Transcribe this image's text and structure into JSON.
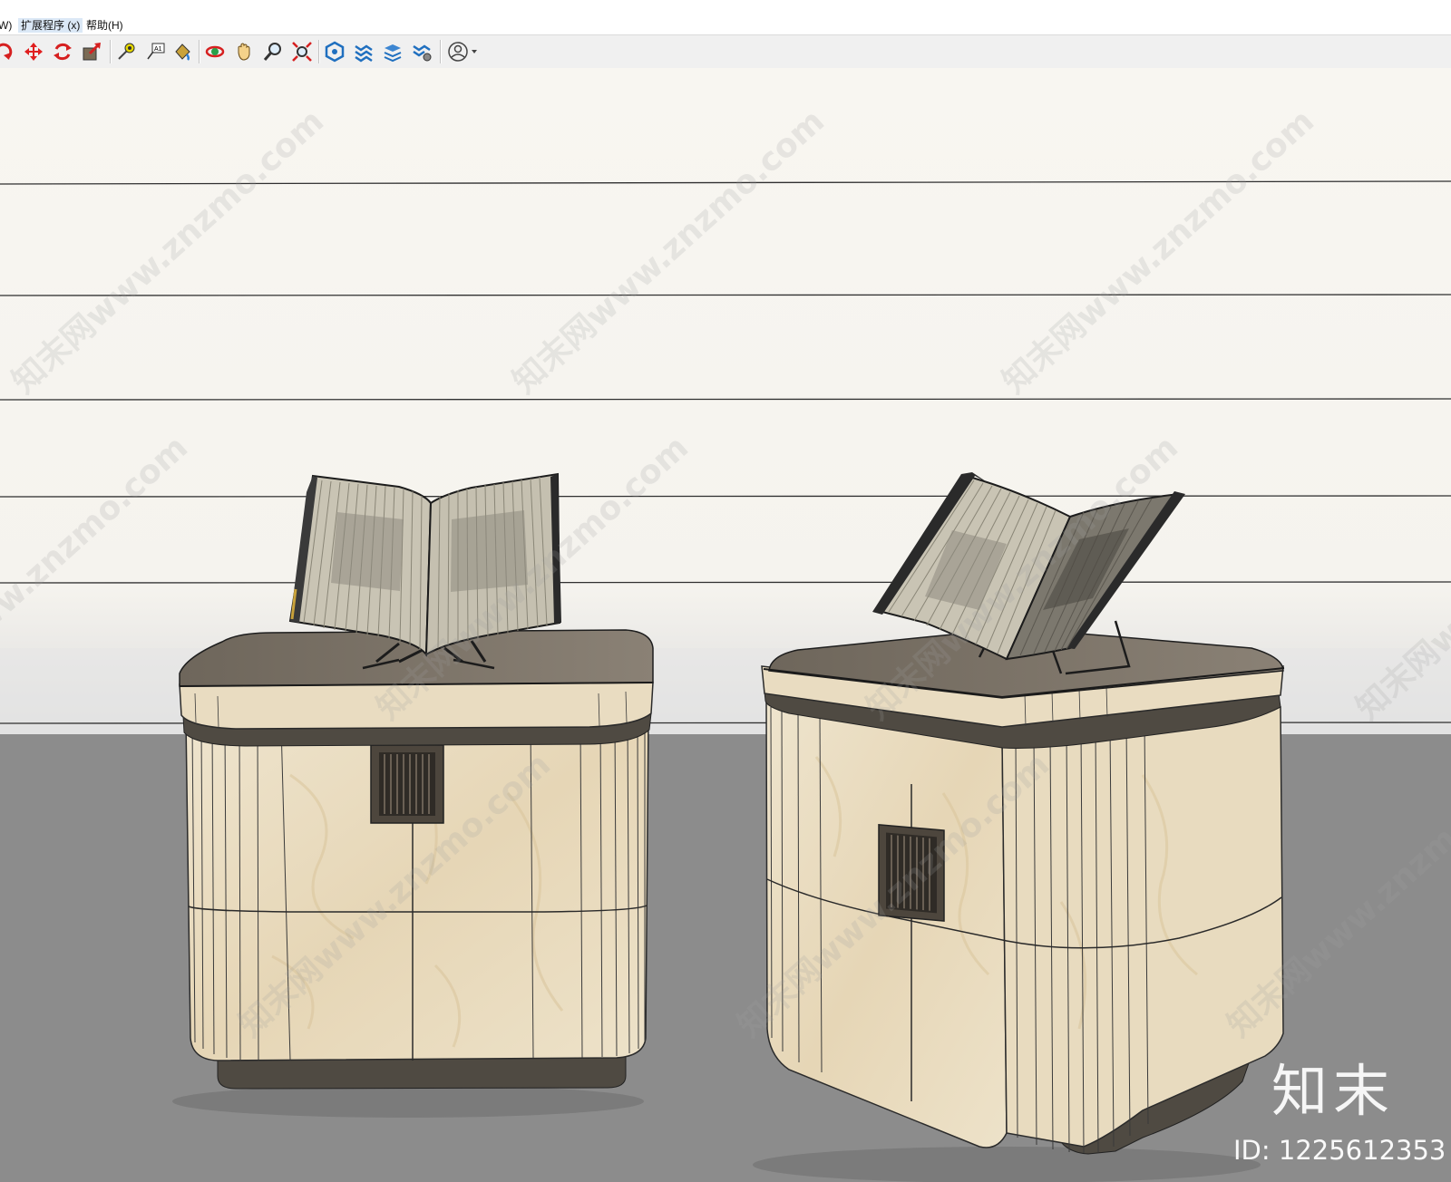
{
  "menubar": {
    "items": [
      {
        "label": "W)"
      },
      {
        "label": "扩展程序 (x)"
      },
      {
        "label": "帮助(H)"
      }
    ]
  },
  "toolbar": {
    "tools": [
      {
        "icon": "rotate-tool-icon"
      },
      {
        "icon": "move-tool-icon"
      },
      {
        "icon": "rotate-arrows-icon"
      },
      {
        "icon": "scale-tool-icon"
      },
      {
        "icon": "tape-measure-icon"
      },
      {
        "icon": "text-label-icon"
      },
      {
        "icon": "paint-bucket-icon"
      },
      {
        "icon": "orbit-icon"
      },
      {
        "icon": "pan-hand-icon"
      },
      {
        "icon": "zoom-icon"
      },
      {
        "icon": "zoom-extents-icon"
      },
      {
        "icon": "components-icon"
      },
      {
        "icon": "layers-icon"
      },
      {
        "icon": "scenes-icon"
      },
      {
        "icon": "styles-icon"
      },
      {
        "icon": "account-icon"
      }
    ]
  },
  "watermark": {
    "text": "知末网www.znzmo.com",
    "brand": "知末",
    "id": "ID: 1225612353"
  },
  "colors": {
    "wall": "#f7f5f0",
    "floor": "#8a8a8a",
    "marble": "#e9dcc1",
    "dark_trim": "#4f4a42"
  }
}
